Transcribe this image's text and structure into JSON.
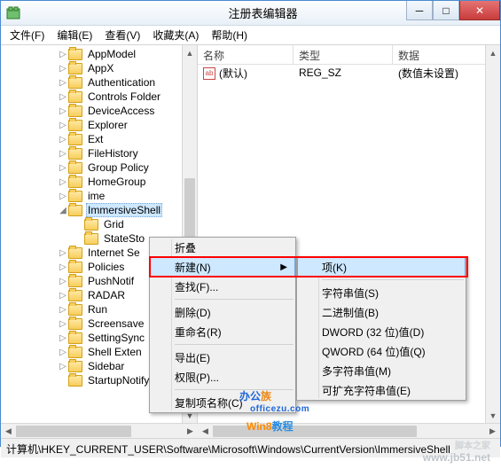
{
  "window": {
    "title": "注册表编辑器",
    "btn_min": "─",
    "btn_max": "□",
    "btn_close": "✕"
  },
  "menubar": [
    "文件(F)",
    "编辑(E)",
    "查看(V)",
    "收藏夹(A)",
    "帮助(H)"
  ],
  "tree": {
    "items": [
      {
        "indent": 64,
        "exp": "▷",
        "label": "AppModel"
      },
      {
        "indent": 64,
        "exp": "▷",
        "label": "AppX"
      },
      {
        "indent": 64,
        "exp": "▷",
        "label": "Authentication"
      },
      {
        "indent": 64,
        "exp": "▷",
        "label": "Controls Folder"
      },
      {
        "indent": 64,
        "exp": "▷",
        "label": "DeviceAccess"
      },
      {
        "indent": 64,
        "exp": "▷",
        "label": "Explorer"
      },
      {
        "indent": 64,
        "exp": "▷",
        "label": "Ext"
      },
      {
        "indent": 64,
        "exp": "▷",
        "label": "FileHistory"
      },
      {
        "indent": 64,
        "exp": "▷",
        "label": "Group Policy"
      },
      {
        "indent": 64,
        "exp": "▷",
        "label": "HomeGroup"
      },
      {
        "indent": 64,
        "exp": "▷",
        "label": "ime"
      },
      {
        "indent": 64,
        "exp": "◢",
        "label": "ImmersiveShell",
        "selected": true
      },
      {
        "indent": 82,
        "exp": "",
        "label": "Grid"
      },
      {
        "indent": 82,
        "exp": "",
        "label": "StateSto"
      },
      {
        "indent": 64,
        "exp": "▷",
        "label": "Internet Se"
      },
      {
        "indent": 64,
        "exp": "▷",
        "label": "Policies"
      },
      {
        "indent": 64,
        "exp": "▷",
        "label": "PushNotif"
      },
      {
        "indent": 64,
        "exp": "▷",
        "label": "RADAR"
      },
      {
        "indent": 64,
        "exp": "▷",
        "label": "Run"
      },
      {
        "indent": 64,
        "exp": "▷",
        "label": "Screensave"
      },
      {
        "indent": 64,
        "exp": "▷",
        "label": "SettingSync"
      },
      {
        "indent": 64,
        "exp": "▷",
        "label": "Shell Exten"
      },
      {
        "indent": 64,
        "exp": "▷",
        "label": "Sidebar"
      },
      {
        "indent": 64,
        "exp": "",
        "label": "StartupNotify"
      }
    ]
  },
  "list": {
    "headers": {
      "name": "名称",
      "type": "类型",
      "data": "数据"
    },
    "rows": [
      {
        "name": "(默认)",
        "type": "REG_SZ",
        "data": "(数值未设置)"
      }
    ]
  },
  "context_menu_1": {
    "collapse": "折叠",
    "new": "新建(N)",
    "find": "查找(F)...",
    "delete": "删除(D)",
    "rename": "重命名(R)",
    "export": "导出(E)",
    "permissions": "权限(P)...",
    "copy_key_name": "复制项名称(C)"
  },
  "context_menu_2": {
    "key": "项(K)",
    "string": "字符串值(S)",
    "binary": "二进制值(B)",
    "dword": "DWORD (32 位)值(D)",
    "qword": "QWORD (64 位)值(Q)",
    "multi": "多字符串值(M)",
    "expand": "可扩充字符串值(E)"
  },
  "statusbar": "计算机\\HKEY_CURRENT_USER\\Software\\Microsoft\\Windows\\CurrentVersion\\ImmersiveShell",
  "watermarks": {
    "w1a": "办公",
    "w1b": "族",
    "w1s": "officezu.com",
    "w2a": "Win8",
    "w2b": "教程",
    "w3": "www.jb51.net",
    "w3s": "脚本之家"
  }
}
